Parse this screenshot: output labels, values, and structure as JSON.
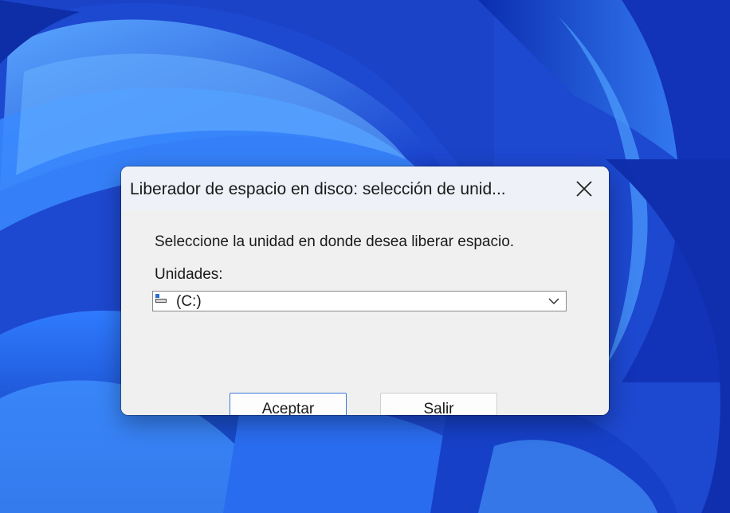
{
  "dialog": {
    "title": "Liberador de espacio en disco: selección de unid...",
    "prompt": "Seleccione la unidad en donde desea liberar espacio.",
    "drives_label": "Unidades:",
    "selected_drive": "(C:)",
    "ok_label": "Aceptar",
    "exit_label": "Salir"
  },
  "icons": {
    "close": "close-icon",
    "drive": "drive-icon",
    "dropdown": "chevron-down-icon"
  },
  "colors": {
    "wallpaper": "#1f4fd6",
    "dialog_background": "#f0f0f0",
    "primary_button_border": "#3c78d8"
  }
}
